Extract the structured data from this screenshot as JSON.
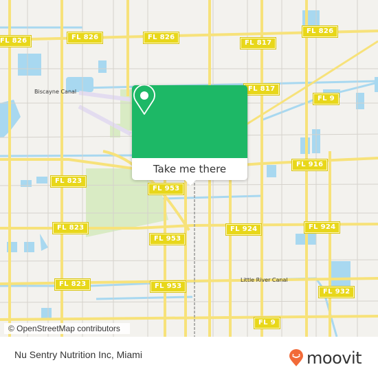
{
  "map": {
    "shields": [
      {
        "label": "FL 826",
        "pos": "top-left-edge"
      },
      {
        "label": "FL 826",
        "pos": "top-left"
      },
      {
        "label": "FL 826",
        "pos": "top-center"
      },
      {
        "label": "FL 826",
        "pos": "top-right"
      },
      {
        "label": "FL 817",
        "pos": "upper-right-1"
      },
      {
        "label": "FL 817",
        "pos": "upper-right-2"
      },
      {
        "label": "FL 9",
        "pos": "right-diagonal"
      },
      {
        "label": "FL 916",
        "pos": "right-middle"
      },
      {
        "label": "FL 823",
        "pos": "left-middle"
      },
      {
        "label": "FL 953",
        "pos": "center"
      },
      {
        "label": "FL 823",
        "pos": "left-lower"
      },
      {
        "label": "FL 953",
        "pos": "center-lower"
      },
      {
        "label": "FL 924",
        "pos": "center-right"
      },
      {
        "label": "FL 924",
        "pos": "right"
      },
      {
        "label": "FL 823",
        "pos": "left-bottom"
      },
      {
        "label": "FL 953",
        "pos": "center-bottom"
      },
      {
        "label": "FL 932",
        "pos": "right-bottom"
      },
      {
        "label": "FL 9",
        "pos": "bottom"
      }
    ],
    "labels": {
      "biscayne_canal": "Biscayne Canal",
      "little_river_canal": "Little River Canal"
    },
    "attribution": "© OpenStreetMap contributors",
    "colors": {
      "land": "#f3f2ee",
      "water": "#a8d8f0",
      "park": "#d9ebc4",
      "road": "#f7e27a",
      "shield": "#e8d71a"
    }
  },
  "popup": {
    "icon": "map-pin-icon",
    "button_label": "Take me there",
    "color": "#1db866"
  },
  "footer": {
    "place_name": "Nu Sentry Nutrition Inc, Miami",
    "brand": "moovit",
    "brand_color": "#f26a38"
  }
}
